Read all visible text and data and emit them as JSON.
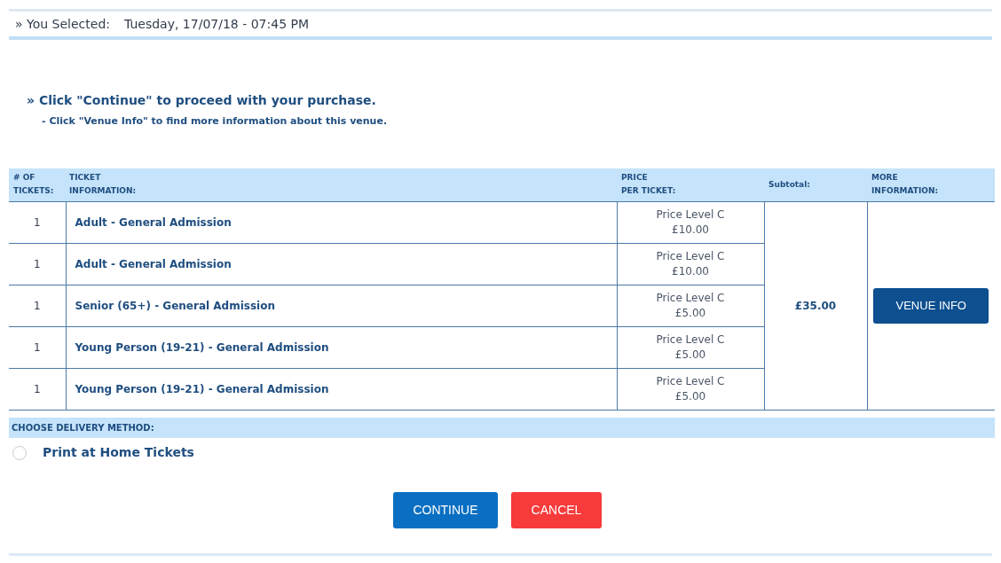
{
  "selection": {
    "label": "» You Selected:",
    "value": "Tuesday, 17/07/18 - 07:45 PM"
  },
  "instructions": {
    "main": "» Click \"Continue\" to proceed with your purchase.",
    "sub": "- Click \"Venue Info\" to find more information about this venue."
  },
  "table": {
    "columns": [
      [
        "# OF",
        "TICKETS:"
      ],
      [
        "TICKET",
        "INFORMATION:"
      ],
      [
        "PRICE",
        "PER TICKET:"
      ],
      [
        "Subtotal:"
      ],
      [
        "MORE",
        "INFORMATION:"
      ]
    ],
    "rows": [
      {
        "count": "1",
        "ticket": "Adult - General Admission",
        "price_level": "Price Level C",
        "price": "£10.00"
      },
      {
        "count": "1",
        "ticket": "Adult - General Admission",
        "price_level": "Price Level C",
        "price": "£10.00"
      },
      {
        "count": "1",
        "ticket": "Senior (65+) - General Admission",
        "price_level": "Price Level C",
        "price": "£5.00"
      },
      {
        "count": "1",
        "ticket": "Young Person (19-21) - General Admission",
        "price_level": "Price Level C",
        "price": "£5.00"
      },
      {
        "count": "1",
        "ticket": "Young Person (19-21) - General Admission",
        "price_level": "Price Level C",
        "price": "£5.00"
      }
    ],
    "subtotal": "£35.00",
    "more_button": "VENUE INFO"
  },
  "delivery": {
    "heading": "CHOOSE DELIVERY METHOD:",
    "options": [
      {
        "label": "Print at Home Tickets",
        "selected": false
      }
    ]
  },
  "buttons": [
    {
      "label": "CONTINUE",
      "kind": "primary"
    },
    {
      "label": "CANCEL",
      "kind": "danger"
    }
  ]
}
